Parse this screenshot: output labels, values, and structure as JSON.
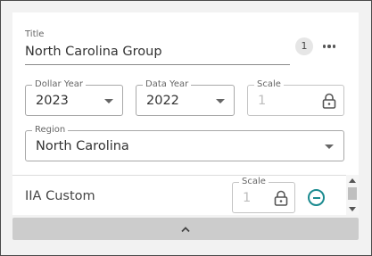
{
  "title_field": {
    "label": "Title",
    "value": "North Carolina Group"
  },
  "badge": {
    "count": "1"
  },
  "menu": {
    "icon": "more-horizontal-icon"
  },
  "dollar_year": {
    "label": "Dollar Year",
    "value": "2023",
    "icon": "chevron-down-icon"
  },
  "data_year": {
    "label": "Data Year",
    "value": "2022",
    "icon": "chevron-down-icon"
  },
  "scale": {
    "label": "Scale",
    "value": "1",
    "icon": "lock-icon"
  },
  "region": {
    "label": "Region",
    "value": "North Carolina",
    "icon": "chevron-down-icon"
  },
  "custom_row": {
    "label": "IIA Custom",
    "scale_label": "Scale",
    "scale_value": "1",
    "remove_icon": "minus-circle-icon"
  },
  "collapse": {
    "icon": "chevron-up-icon"
  },
  "colors": {
    "accent": "#1a8a8f",
    "bar": "#cccccc",
    "border": "#a8a8a8"
  }
}
